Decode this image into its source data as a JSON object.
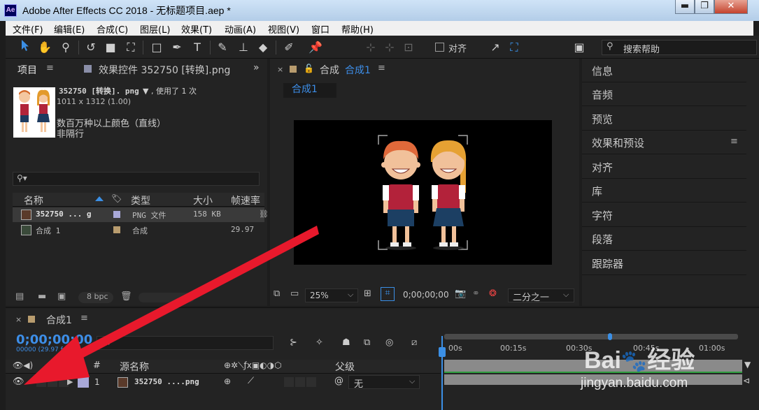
{
  "window": {
    "app_icon": "Ae",
    "title": "Adobe After Effects CC 2018 - 无标题项目.aep *",
    "min_glyph": "▬",
    "max_glyph": "❐",
    "close_glyph": "✕"
  },
  "menu": [
    {
      "label": "文件(F)"
    },
    {
      "label": "编辑(E)"
    },
    {
      "label": "合成(C)"
    },
    {
      "label": "图层(L)"
    },
    {
      "label": "效果(T)"
    },
    {
      "label": "动画(A)"
    },
    {
      "label": "视图(V)"
    },
    {
      "label": "窗口"
    },
    {
      "label": "帮助(H)"
    }
  ],
  "toolbar": {
    "align_label": "对齐",
    "search_help": "搜索帮助"
  },
  "project": {
    "tab_label": "项目",
    "effects_tab_label": "效果控件 352750 [转换].png",
    "more_glyph": "»",
    "asset_name": "352750 [转换]. png",
    "usage": "▼ , 使用了 1 次",
    "dimensions": "1011 x 1312 (1.00)",
    "color_desc": "数百万种以上颜色（直线）",
    "alpha_desc": "非隔行",
    "columns": {
      "name": "名称",
      "type": "类型",
      "size": "大小",
      "fps": "帧速率"
    },
    "rows": [
      {
        "name": "352750 ... g",
        "type": "PNG 文件",
        "size": "158 KB",
        "fps": ""
      },
      {
        "name": "合成 1",
        "type": "合成",
        "size": "",
        "fps": "29.97"
      }
    ],
    "bpc": "8 bpc"
  },
  "comp": {
    "tab_label": "合成",
    "tab_name": "合成1",
    "sub_tab": "合成1",
    "zoom": "25%",
    "timecode": "0;00;00;00",
    "resolution": "二分之一"
  },
  "right_panel": [
    {
      "label": "信息"
    },
    {
      "label": "音频"
    },
    {
      "label": "预览"
    },
    {
      "label": "效果和预设"
    },
    {
      "label": "对齐"
    },
    {
      "label": "库"
    },
    {
      "label": "字符"
    },
    {
      "label": "段落"
    },
    {
      "label": "跟踪器"
    }
  ],
  "timeline": {
    "tab_label": "合成1",
    "timecode": "0;00;00;00",
    "frames": "00000 (29.97 fps)",
    "col_source_name": "源名称",
    "col_parent": "父级",
    "hash": "#",
    "layer": {
      "index": "1",
      "name": "352750 ....png",
      "parent": "无"
    },
    "ruler": [
      "00s",
      "00:15s",
      "00:30s",
      "00:45s",
      "01:00s"
    ]
  },
  "watermark": {
    "logo": "Bai",
    "logo_cn": "经验",
    "url": "jingyan.baidu.com"
  },
  "colors": {
    "accent": "#3b8fe5",
    "arrow": "#e8192c",
    "label_swatch": "#b89c6e"
  }
}
